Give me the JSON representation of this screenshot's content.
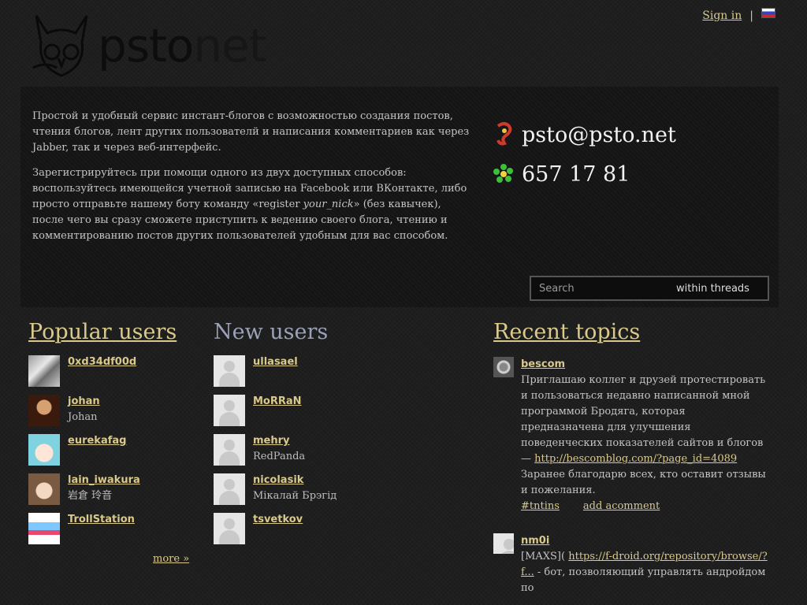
{
  "header": {
    "logo_part1": "psto",
    "logo_part2": "net",
    "sign_in": "Sign in",
    "separator": "|",
    "language_flag": "ru-flag-icon"
  },
  "intro": {
    "paragraph1": "Простой и удобный сервис инстант-блогов с возможностью создания постов, чтения блогов, лент других пользователй и написания комментариев как через Jabber, так и через веб-интерфейс.",
    "paragraph2_before": "Зарегистрируйтесь при помощи одного из двух доступных способов: воспользуйтесь имеющейся учетной записью на Facebook или ВКонтакте, либо просто отправьте нашему боту команду «register ",
    "paragraph2_italic": "your_nick",
    "paragraph2_after": "» (без кавычек), после чего вы сразу сможете приступить к ведению своего блога, чтению и комментированию постов других пользователей удобным для вас способом."
  },
  "contacts": {
    "jabber": "psto@psto.net",
    "icq": "657 17 81"
  },
  "search": {
    "placeholder": "Search",
    "scope": "within threads"
  },
  "popular_users": {
    "title": "Popular users",
    "more": "more »",
    "items": [
      {
        "nick": "0xd34df00d",
        "name": ""
      },
      {
        "nick": "johan",
        "name": "Johan"
      },
      {
        "nick": "eurekafag",
        "name": ""
      },
      {
        "nick": "lain_iwakura",
        "name": "岩倉 玲音"
      },
      {
        "nick": "TrollStation",
        "name": ""
      }
    ]
  },
  "new_users": {
    "title": "New users",
    "items": [
      {
        "nick": "ullasael",
        "name": ""
      },
      {
        "nick": "MoRRaN",
        "name": ""
      },
      {
        "nick": "mehry",
        "name": "RedPanda"
      },
      {
        "nick": "nicolasik",
        "name": "Мікалай Брэгід"
      },
      {
        "nick": "tsvetkov",
        "name": ""
      }
    ]
  },
  "recent_topics": {
    "title": "Recent topics",
    "items": [
      {
        "author": "bescom",
        "text1": "Приглашаю коллег и друзей протестировать и пользоваться недавно написанной мной программой Бродяга, которая предназначена для улучшения поведенческих показателей сайтов и блогов — ",
        "link": "http://bescomblog.com/?page_id=4089",
        "text2": "Заранее благодарю всех, кто оставит отзывы и пожелания.",
        "tag": "#tntins",
        "comment": "add acomment"
      },
      {
        "author": "nm0i",
        "text1": "[MAXS]( ",
        "link": "https://f-droid.org/repository/browse/?f...",
        "text2": " - бот, позволяющий управлять андройдом по"
      }
    ]
  }
}
